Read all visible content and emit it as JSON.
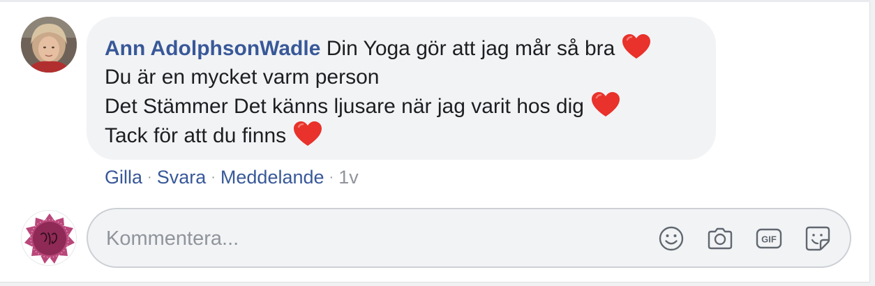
{
  "comment": {
    "author": "Ann AdolphsonWadle",
    "lines": [
      "Din Yoga gör att jag mår så bra",
      "Du är en mycket varm person",
      "Det Stämmer Det känns ljusare när jag varit hos dig",
      "Tack för att du finns"
    ]
  },
  "actions": {
    "like": "Gilla",
    "reply": "Svara",
    "message": "Meddelande",
    "separator": "·",
    "time": "1v"
  },
  "composer": {
    "placeholder": "Kommentera...",
    "icons": [
      "smiley-icon",
      "camera-icon",
      "gif-icon",
      "sticker-icon"
    ]
  },
  "colors": {
    "link": "#385898",
    "bubble": "#f2f3f5",
    "heart": "#e8322b",
    "muted": "#90949c"
  }
}
